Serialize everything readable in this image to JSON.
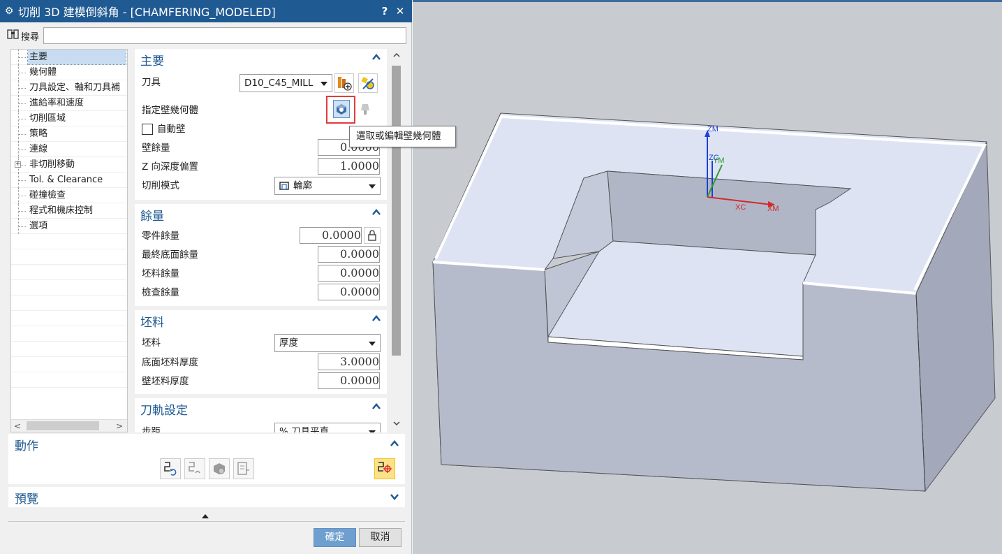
{
  "dialog": {
    "title": "切削 3D 建模倒斜角 - [CHAMFERING_MODELED]",
    "help_label": "?",
    "close_label": "✕",
    "search_label": "搜尋",
    "search_value": ""
  },
  "tree": {
    "items": [
      {
        "label": "主要",
        "selected": true
      },
      {
        "label": "幾何體"
      },
      {
        "label": "刀具設定、軸和刀具補"
      },
      {
        "label": "進給率和速度"
      },
      {
        "label": "切削區域"
      },
      {
        "label": "策略"
      },
      {
        "label": "連線"
      },
      {
        "label": "非切削移動",
        "expandable": true
      },
      {
        "label": "Tol. & Clearance"
      },
      {
        "label": "碰撞檢查"
      },
      {
        "label": "程式和機床控制"
      },
      {
        "label": "選項"
      }
    ]
  },
  "main": {
    "title": "主要",
    "tool_label": "刀具",
    "tool_value": "D10_C45_MILL",
    "wall_geometry_label": "指定壁幾何體",
    "auto_wall_label": "自動壁",
    "wall_stock_label": "壁餘量",
    "wall_stock_value": "0.0000",
    "z_depth_label": "Z 向深度偏置",
    "z_depth_value": "1.0000",
    "cut_mode_label": "切削模式",
    "cut_mode_value": "輪廓"
  },
  "stock": {
    "title": "餘量",
    "part_label": "零件餘量",
    "part_value": "0.0000",
    "floor_label": "最終底面餘量",
    "floor_value": "0.0000",
    "blank_label": "坯料餘量",
    "blank_value": "0.0000",
    "check_label": "檢查餘量",
    "check_value": "0.0000"
  },
  "blank": {
    "title": "坯料",
    "blank_label": "坯料",
    "blank_value": "厚度",
    "floor_thk_label": "底面坯料厚度",
    "floor_thk_value": "3.0000",
    "wall_thk_label": "壁坯料厚度",
    "wall_thk_value": "0.0000"
  },
  "path": {
    "title": "刀軌設定",
    "stepover_label": "步距",
    "stepover_value": "% 刀具平直"
  },
  "actions": {
    "title": "動作"
  },
  "preview": {
    "title": "預覽"
  },
  "tooltip": "選取或編輯壁幾何體",
  "buttons": {
    "ok": "確定",
    "cancel": "取消"
  },
  "axes": {
    "zm": "ZM",
    "zc": "ZC",
    "ym": "YM",
    "xc": "XC",
    "xm": "XM"
  },
  "colors": {
    "title_bar": "#1f5a93",
    "group_title": "#1f5a93",
    "ok_button": "#6f9fcf",
    "highlight_box": "#e23b3b",
    "model_top": "#dde3f3",
    "model_side": "#b3b8c9"
  }
}
